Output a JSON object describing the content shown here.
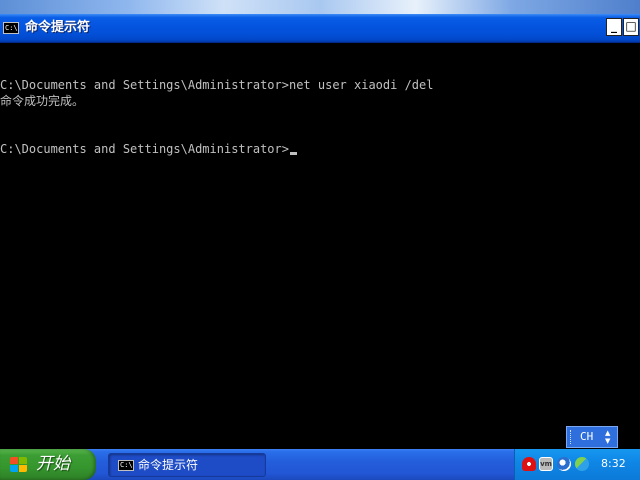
{
  "window": {
    "title": "命令提示符",
    "icon": "console-icon",
    "icon_text": "C:\\",
    "buttons": {
      "restore": "restore-icon",
      "close": "close-icon"
    }
  },
  "console": {
    "lines": [
      "C:\\Documents and Settings\\Administrator>net user xiaodi /del",
      "命令成功完成。",
      "C:\\Documents and Settings\\Administrator>"
    ]
  },
  "language_bar": {
    "label": "CH"
  },
  "taskbar": {
    "start_label": "开始",
    "tasks": [
      {
        "label": "命令提示符",
        "icon": "console-icon",
        "icon_text": "C:\\"
      }
    ],
    "tray": {
      "icons": [
        "shield-icon",
        "vmware-icon",
        "audio-icon",
        "network-icon"
      ],
      "vm_text": "vm",
      "clock": "8:32"
    }
  },
  "colors": {
    "console_bg": "#000000",
    "console_text": "#c0c0c0",
    "titlebar": "#0555e0",
    "taskbar": "#245edb",
    "start": "#3c9d34"
  }
}
